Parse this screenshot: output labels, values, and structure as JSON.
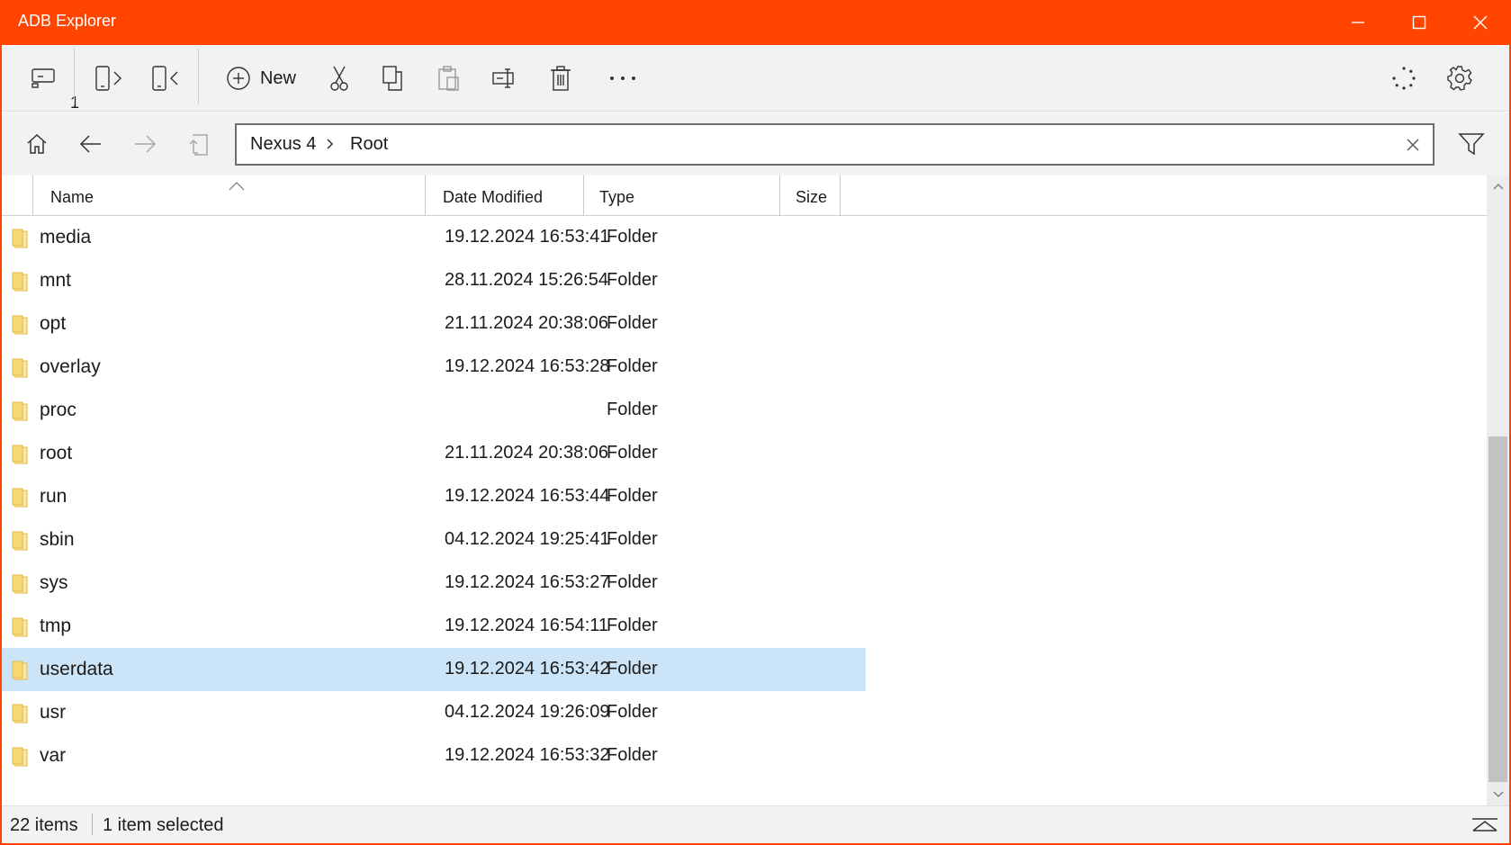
{
  "window": {
    "title": "ADB Explorer",
    "accent_color": "#ff4500",
    "controls": [
      "minimize-icon",
      "maximize-icon",
      "close-icon"
    ]
  },
  "toolbar": {
    "device_badge": "1",
    "new_label": "New",
    "icons": [
      "devices-icon",
      "push-to-device-icon",
      "pull-from-device-icon",
      "new-icon",
      "cut-icon",
      "copy-icon",
      "paste-icon",
      "rename-icon",
      "delete-icon",
      "more-icon",
      "progress-icon",
      "settings-icon"
    ]
  },
  "navigation": {
    "icons": [
      "home-icon",
      "back-icon",
      "forward-icon",
      "parent-folder-icon",
      "filter-icon",
      "clear-icon"
    ],
    "breadcrumb": [
      "Nexus 4",
      "Root"
    ]
  },
  "columns": {
    "name": "Name",
    "date": "Date Modified",
    "type": "Type",
    "size": "Size"
  },
  "files": [
    {
      "name": "media",
      "date": "19.12.2024 16:53:41",
      "type": "Folder"
    },
    {
      "name": "mnt",
      "date": "28.11.2024 15:26:54",
      "type": "Folder"
    },
    {
      "name": "opt",
      "date": "21.11.2024 20:38:06",
      "type": "Folder"
    },
    {
      "name": "overlay",
      "date": "19.12.2024 16:53:28",
      "type": "Folder"
    },
    {
      "name": "proc",
      "date": "",
      "type": "Folder"
    },
    {
      "name": "root",
      "date": "21.11.2024 20:38:06",
      "type": "Folder"
    },
    {
      "name": "run",
      "date": "19.12.2024 16:53:44",
      "type": "Folder"
    },
    {
      "name": "sbin",
      "date": "04.12.2024 19:25:41",
      "type": "Folder"
    },
    {
      "name": "sys",
      "date": "19.12.2024 16:53:27",
      "type": "Folder"
    },
    {
      "name": "tmp",
      "date": "19.12.2024 16:54:11",
      "type": "Folder"
    },
    {
      "name": "userdata",
      "date": "19.12.2024 16:53:42",
      "type": "Folder",
      "selected": true
    },
    {
      "name": "usr",
      "date": "04.12.2024 19:26:09",
      "type": "Folder"
    },
    {
      "name": "var",
      "date": "19.12.2024 16:53:32",
      "type": "Folder"
    }
  ],
  "status": {
    "item_count": "22 items",
    "selection": "1 item selected"
  }
}
